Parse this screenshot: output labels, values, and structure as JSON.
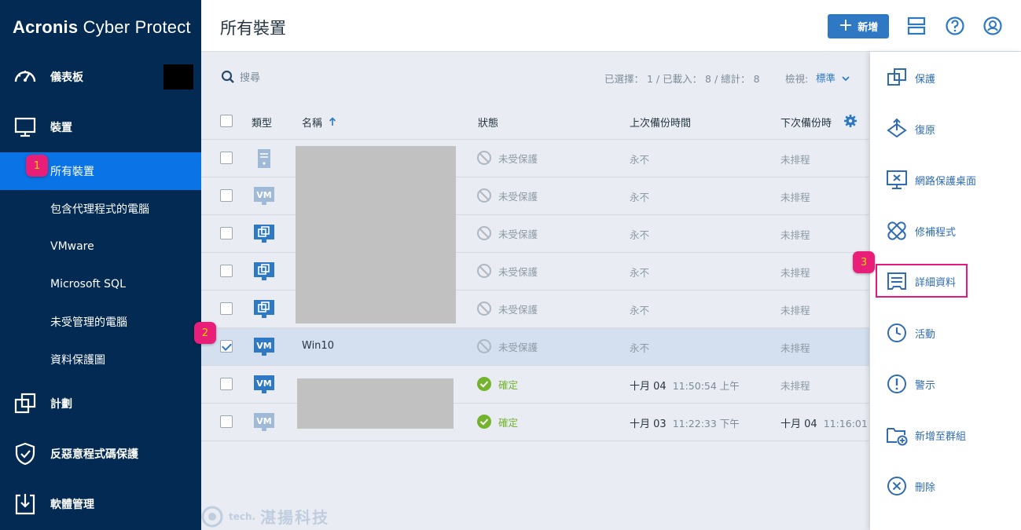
{
  "brand": {
    "part1": "Acronis",
    "part2": "Cyber Protect"
  },
  "sidebar": {
    "items": [
      {
        "label": "儀表板",
        "icon": "dashboard-icon"
      },
      {
        "label": "裝置",
        "icon": "monitor-icon"
      },
      {
        "label": "計劃",
        "icon": "plans-icon"
      },
      {
        "label": "反惡意程式碼保護",
        "icon": "shield-icon"
      },
      {
        "label": "軟體管理",
        "icon": "software-management-icon"
      }
    ],
    "sub_items": [
      {
        "label": "所有裝置",
        "active": true
      },
      {
        "label": "包含代理程式的電腦"
      },
      {
        "label": "VMware"
      },
      {
        "label": "Microsoft SQL"
      },
      {
        "label": "未受管理的電腦"
      },
      {
        "label": "資料保護圖"
      }
    ]
  },
  "header": {
    "title": "所有裝置",
    "add_label": "新增"
  },
  "toolbar": {
    "search_placeholder": "搜尋",
    "selection_summary": "已選擇： 1 / 已載入： 8 / 總計： 8",
    "view_label": "檢視:",
    "view_value": "標準"
  },
  "table": {
    "columns": {
      "type": "類型",
      "name": "名稱",
      "status": "狀態",
      "last_backup": "上次備份時間",
      "next_backup": "下次備份時"
    },
    "rows": [
      {
        "type": "server",
        "name": "",
        "status": "未受保護",
        "status_kind": "unprotected",
        "last_backup": "永不",
        "last_time": "",
        "next_backup": "未排程",
        "next_time": "",
        "checked": false
      },
      {
        "type": "vm-faded",
        "name": "",
        "status": "未受保護",
        "status_kind": "unprotected",
        "last_backup": "永不",
        "last_time": "",
        "next_backup": "未排程",
        "next_time": "",
        "checked": false
      },
      {
        "type": "group",
        "name": "",
        "status": "未受保護",
        "status_kind": "unprotected",
        "last_backup": "永不",
        "last_time": "",
        "next_backup": "未排程",
        "next_time": "",
        "checked": false
      },
      {
        "type": "group",
        "name": "",
        "status": "未受保護",
        "status_kind": "unprotected",
        "last_backup": "永不",
        "last_time": "",
        "next_backup": "未排程",
        "next_time": "",
        "checked": false
      },
      {
        "type": "group",
        "name": "",
        "status": "未受保護",
        "status_kind": "unprotected",
        "last_backup": "永不",
        "last_time": "",
        "next_backup": "未排程",
        "next_time": "",
        "checked": false
      },
      {
        "type": "vm",
        "name": "Win10",
        "status": "未受保護",
        "status_kind": "unprotected",
        "last_backup": "永不",
        "last_time": "",
        "next_backup": "未排程",
        "next_time": "",
        "checked": true
      },
      {
        "type": "vm",
        "name": "",
        "status": "確定",
        "status_kind": "ok",
        "last_backup": "十月 04",
        "last_time": "11:50:54 上午",
        "next_backup": "未排程",
        "next_time": "",
        "checked": false
      },
      {
        "type": "vm-faded",
        "name": "",
        "status": "確定",
        "status_kind": "ok",
        "last_backup": "十月 03",
        "last_time": "11:22:33 下午",
        "next_backup": "十月 04",
        "next_time": "11:16:01",
        "checked": false
      }
    ]
  },
  "actions": [
    {
      "label": "保護",
      "icon": "protect-icon"
    },
    {
      "label": "復原",
      "icon": "recover-icon"
    },
    {
      "label": "網路保護桌面",
      "icon": "remote-desktop-icon"
    },
    {
      "label": "修補程式",
      "icon": "patch-icon"
    },
    {
      "label": "詳細資料",
      "icon": "details-icon",
      "highlight": true
    },
    {
      "label": "活動",
      "icon": "activities-icon"
    },
    {
      "label": "警示",
      "icon": "alert-icon"
    },
    {
      "label": "新增至群組",
      "icon": "add-to-group-icon"
    },
    {
      "label": "刪除",
      "icon": "delete-icon"
    }
  ],
  "badges": [
    "1",
    "2",
    "3"
  ],
  "watermark": {
    "small": "tech.",
    "text": "湛揚科技"
  },
  "colors": {
    "sidebar": "#022a52",
    "active": "#0a74e6",
    "accent": "#2f78c4",
    "ok": "#73b32e",
    "badge": "#e81e78"
  }
}
